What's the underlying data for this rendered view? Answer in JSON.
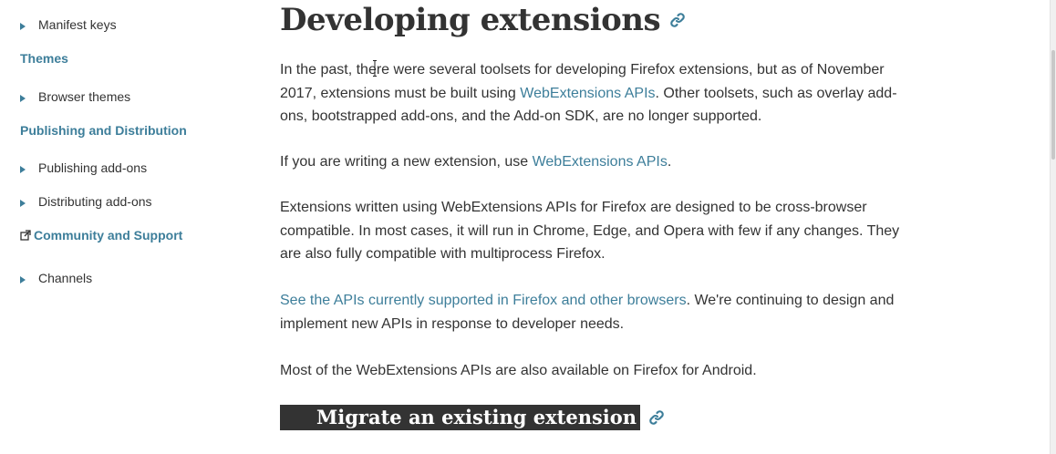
{
  "sidebar": {
    "items": [
      {
        "label": "Manifest keys"
      },
      {
        "label": "Themes"
      },
      {
        "label": "Browser themes"
      },
      {
        "label": "Publishing and Distribution"
      },
      {
        "label": "Publishing add-ons"
      },
      {
        "label": "Distributing add-ons"
      },
      {
        "label": "Community and Support"
      },
      {
        "label": "Channels"
      }
    ]
  },
  "main": {
    "title": "Developing extensions",
    "p1": {
      "before": "In the past, there were several toolsets for developing Firefox extensions, but as of November 2017, extensions must be built using ",
      "link": "WebExtensions APIs",
      "after": ". Other toolsets, such as overlay add-ons, bootstrapped add-ons, and the Add-on SDK, are no longer supported."
    },
    "p2": {
      "before": "If you are writing a new extension, use ",
      "link": "WebExtensions APIs",
      "after": "."
    },
    "p3": "Extensions written using WebExtensions APIs for Firefox are designed to be cross-browser compatible. In most cases, it will run in Chrome, Edge, and Opera with few if any changes. They are also fully compatible with multiprocess Firefox.",
    "p4": {
      "link": "See the APIs currently supported in Firefox and other browsers",
      "after": ". We're continuing to design and implement new APIs in response to developer needs."
    },
    "p5": "Most of the WebExtensions APIs are also available on Firefox for Android.",
    "section_heading": "Migrate an existing extension"
  },
  "colors": {
    "link": "#3d7e9a",
    "text": "#333333",
    "heading_band": "#333333"
  },
  "icons": {
    "expand": "triangle-right-icon",
    "external": "external-link-icon",
    "anchor": "chain-link-icon"
  }
}
